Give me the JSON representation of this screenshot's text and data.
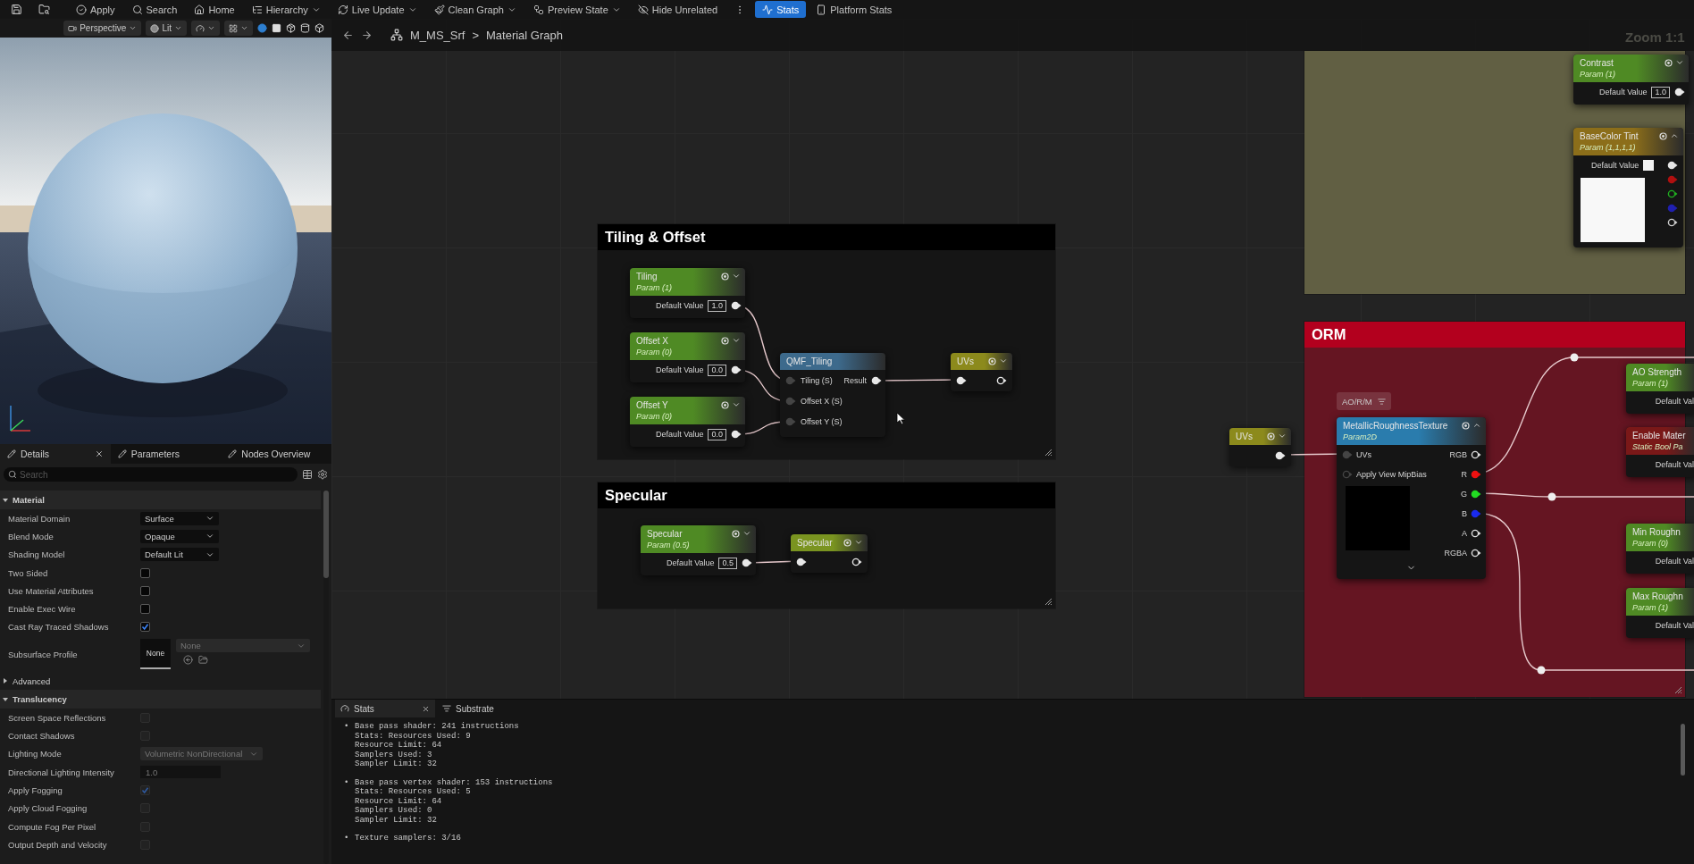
{
  "toolbar": {
    "buttons": [
      {
        "kind": "button",
        "label": "Apply",
        "dropdown": false,
        "selected": false
      },
      {
        "kind": "button",
        "label": "Search",
        "dropdown": false,
        "selected": false
      },
      {
        "kind": "button",
        "label": "Home",
        "dropdown": false,
        "selected": false
      },
      {
        "kind": "button",
        "label": "Hierarchy",
        "dropdown": true,
        "selected": false
      },
      {
        "kind": "button",
        "label": "Live Update",
        "dropdown": true,
        "selected": false
      },
      {
        "kind": "button",
        "label": "Clean Graph",
        "dropdown": true,
        "selected": false
      },
      {
        "kind": "button",
        "label": "Preview State",
        "dropdown": true,
        "selected": false
      },
      {
        "kind": "button",
        "label": "Hide Unrelated",
        "dropdown": false,
        "selected": false
      },
      {
        "kind": "overflow"
      },
      {
        "kind": "button",
        "label": "Stats",
        "dropdown": false,
        "selected": true
      },
      {
        "kind": "button",
        "label": "Platform Stats",
        "dropdown": false,
        "selected": false
      }
    ]
  },
  "viewport": {
    "toolbar": [
      {
        "label": "Perspective",
        "dropdown": true
      },
      {
        "label": "Lit",
        "dropdown": true
      }
    ]
  },
  "breadcrumb": {
    "asset": "M_MS_Srf",
    "separator": ">",
    "graph": "Material Graph"
  },
  "details": {
    "tabs": [
      {
        "label": "Details",
        "selected": true,
        "closable": true
      },
      {
        "label": "Parameters",
        "selected": false,
        "closable": false
      },
      {
        "label": "Nodes Overview",
        "selected": false,
        "closable": false
      }
    ],
    "search": {
      "placeholder": "Search"
    },
    "sections": [
      {
        "kind": "category",
        "title": "Material",
        "expanded": true,
        "rows": [
          {
            "kind": "dropdown",
            "label": "Material Domain",
            "value": "Surface",
            "disabled": false
          },
          {
            "kind": "dropdown",
            "label": "Blend Mode",
            "value": "Opaque",
            "disabled": false
          },
          {
            "kind": "dropdown",
            "label": "Shading Model",
            "value": "Default Lit",
            "disabled": false
          },
          {
            "kind": "checkbox",
            "label": "Two Sided",
            "checked": false,
            "disabled": false
          },
          {
            "kind": "checkbox",
            "label": "Use Material Attributes",
            "checked": false,
            "disabled": false
          },
          {
            "kind": "checkbox",
            "label": "Enable Exec Wire",
            "checked": false,
            "disabled": false
          },
          {
            "kind": "checkbox",
            "label": "Cast Ray Traced Shadows",
            "checked": true,
            "disabled": false
          },
          {
            "kind": "asset",
            "label": "Subsurface Profile",
            "thumbnail": "None",
            "value": "None",
            "disabled": true
          }
        ]
      },
      {
        "kind": "group",
        "title": "Advanced",
        "expanded": false
      },
      {
        "kind": "category",
        "title": "Translucency",
        "expanded": true,
        "rows": [
          {
            "kind": "checkbox",
            "label": "Screen Space Reflections",
            "checked": false,
            "disabled": true
          },
          {
            "kind": "checkbox",
            "label": "Contact Shadows",
            "checked": false,
            "disabled": true
          },
          {
            "kind": "dropdown",
            "label": "Lighting Mode",
            "value": "Volumetric NonDirectional",
            "disabled": true
          },
          {
            "kind": "number",
            "label": "Directional Lighting Intensity",
            "value": "1.0",
            "disabled": true
          },
          {
            "kind": "checkbox",
            "label": "Apply Fogging",
            "checked": true,
            "disabled": true
          },
          {
            "kind": "checkbox",
            "label": "Apply Cloud Fogging",
            "checked": false,
            "disabled": true
          },
          {
            "kind": "checkbox",
            "label": "Compute Fog Per Pixel",
            "checked": false,
            "disabled": true
          },
          {
            "kind": "checkbox",
            "label": "Output Depth and Velocity",
            "checked": false,
            "disabled": true
          }
        ]
      }
    ]
  },
  "graph": {
    "zoom": "Zoom 1:1",
    "comments": [
      {
        "title": "Tiling & Offset",
        "color": "#000000"
      },
      {
        "title": "Specular",
        "color": "#000000"
      },
      {
        "color": "#615f43"
      },
      {
        "title": "ORM",
        "color": "#b3001e"
      }
    ],
    "nodes": [
      {
        "kind": "param",
        "title": "Tiling",
        "subtitle": "Param (1)",
        "field": "Default Value",
        "value": "1.0",
        "expanded": false,
        "color": "#4f8a24"
      },
      {
        "kind": "param",
        "title": "Offset X",
        "subtitle": "Param (0)",
        "field": "Default Value",
        "value": "0.0",
        "expanded": false,
        "color": "#4f8a24"
      },
      {
        "kind": "param",
        "title": "Offset Y",
        "subtitle": "Param (0)",
        "field": "Default Value",
        "value": "0.0",
        "expanded": false,
        "color": "#4f8a24"
      },
      {
        "kind": "function",
        "title": "QMF_Tiling",
        "inputs": [
          "Tiling (S)",
          "Offset X (S)",
          "Offset Y (S)"
        ],
        "outputs": [
          "Result"
        ],
        "color": "#3d6a8c"
      },
      {
        "kind": "declaration",
        "title": "UVs",
        "expanded": false,
        "color": "#8c8a1c"
      },
      {
        "kind": "param",
        "title": "Specular",
        "subtitle": "Param (0.5)",
        "field": "Default Value",
        "value": "0.5",
        "expanded": false,
        "color": "#4f8a24"
      },
      {
        "kind": "declaration",
        "title": "Specular",
        "expanded": false,
        "color": "#7a9420"
      },
      {
        "kind": "param",
        "title": "Contrast",
        "subtitle": "Param (1)",
        "field": "Default Value",
        "value": "1.0",
        "expanded": false,
        "color": "#4f8a24"
      },
      {
        "kind": "vector",
        "title": "BaseColor Tint",
        "subtitle": "Param (1,1,1,1)",
        "field": "Default Value",
        "expanded": true,
        "color": "#8c6e1a",
        "outputs": [
          {
            "color": "#e6e6e6",
            "connected": true
          },
          {
            "color": "#b01010",
            "connected": true
          },
          {
            "color": "#20b020",
            "connected": false
          },
          {
            "color": "#2020b0",
            "connected": true
          },
          {
            "color": "#d0d0d0",
            "connected": false
          }
        ]
      },
      {
        "kind": "usage",
        "title": "UVs",
        "expanded": false,
        "color": "#8c8a1c"
      },
      {
        "kind": "texture",
        "title": "MetallicRoughnessTexture",
        "subtitle": "Param2D",
        "label": "AO/R/M",
        "expanded": true,
        "color": "#2a7cad",
        "inputs": [
          "UVs",
          "Apply View MipBias"
        ],
        "outputs": [
          {
            "label": "RGB",
            "color": "#e0e0e0",
            "connected": false
          },
          {
            "label": "R",
            "color": "#ee1111",
            "connected": true
          },
          {
            "label": "G",
            "color": "#22dd22",
            "connected": true
          },
          {
            "label": "B",
            "color": "#1a2aee",
            "connected": true
          },
          {
            "label": "A",
            "color": "#e0e0e0",
            "connected": false
          },
          {
            "label": "RGBA",
            "color": "#e0e0e0",
            "connected": false
          }
        ]
      },
      {
        "kind": "param",
        "title": "AO Strength",
        "subtitle": "Param (1)",
        "field": "Default Val",
        "color": "#4f8a24"
      },
      {
        "kind": "param",
        "title": "Enable Mater",
        "subtitle": "Static Bool Pa",
        "field": "Default Val",
        "color": "#7a1818"
      },
      {
        "kind": "param",
        "title": "Min Roughn",
        "subtitle": "Param (0)",
        "field": "Default Val",
        "color": "#4f8a24"
      },
      {
        "kind": "param",
        "title": "Max Roughn",
        "subtitle": "Param (1)",
        "field": "Default Val",
        "color": "#4f8a24"
      }
    ]
  },
  "stats": {
    "tabs": [
      {
        "label": "Stats",
        "selected": true,
        "closable": true
      },
      {
        "label": "Substrate",
        "selected": false,
        "closable": false
      }
    ],
    "entries": [
      {
        "bullet": "•",
        "lines": [
          "Base pass shader: 241 instructions",
          "Stats: Resources Used: 9",
          "Resource Limit: 64",
          "Samplers Used: 3",
          "Sampler Limit: 32"
        ]
      },
      {
        "bullet": "•",
        "lines": [
          "Base pass vertex shader: 153 instructions",
          "Stats: Resources Used: 5",
          "Resource Limit: 64",
          "Samplers Used: 0",
          "Sampler Limit: 32"
        ]
      },
      {
        "bullet": "•",
        "lines": [
          "Texture samplers: 3/16"
        ]
      }
    ]
  }
}
